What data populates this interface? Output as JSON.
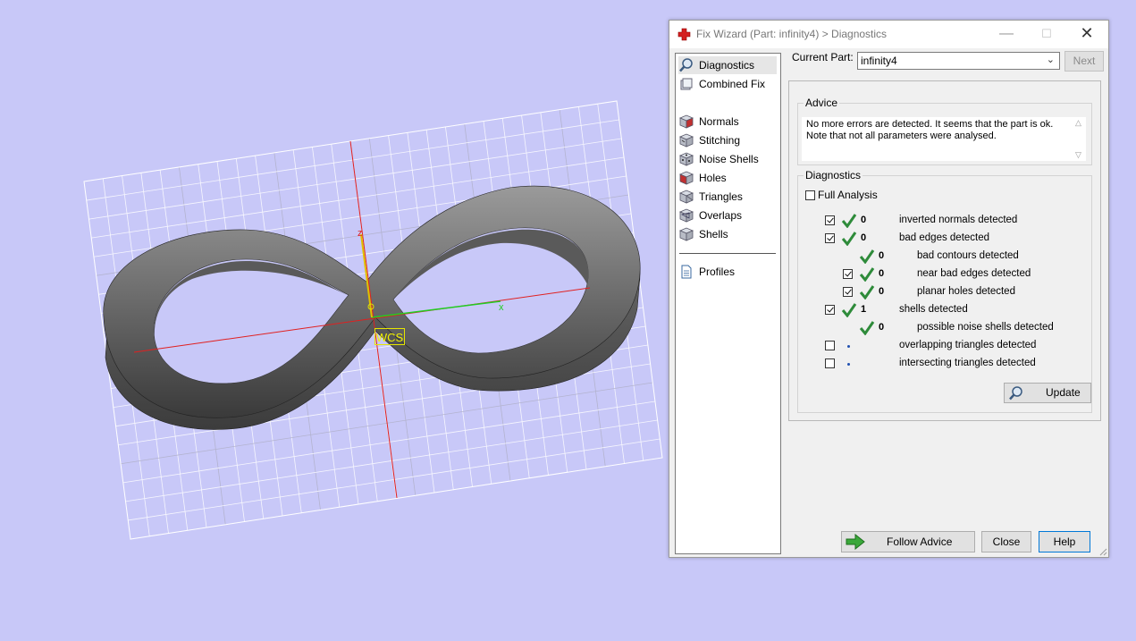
{
  "viewport": {
    "wcs_label": "WCS",
    "axis_x_label": "x",
    "axis_z_label": "z"
  },
  "window": {
    "title": "Fix Wizard (Part: infinity4) > Diagnostics",
    "controls": [
      "minimize",
      "maximize",
      "close"
    ]
  },
  "nav": {
    "items": [
      {
        "label": "Diagnostics",
        "icon": "magnifier-icon",
        "selected": true
      },
      {
        "label": "Combined Fix",
        "icon": "combined-fix-icon"
      },
      {
        "label": "Normals",
        "icon": "normals-cube-icon"
      },
      {
        "label": "Stitching",
        "icon": "stitching-cube-icon"
      },
      {
        "label": "Noise Shells",
        "icon": "noise-shells-icon"
      },
      {
        "label": "Holes",
        "icon": "holes-cube-icon"
      },
      {
        "label": "Triangles",
        "icon": "triangles-cube-icon"
      },
      {
        "label": "Overlaps",
        "icon": "overlaps-cube-icon"
      },
      {
        "label": "Shells",
        "icon": "shells-cube-icon"
      },
      {
        "label": "Profiles",
        "icon": "profiles-document-icon"
      }
    ]
  },
  "current_part": {
    "label": "Current Part:",
    "value": "infinity4",
    "next_label": "Next"
  },
  "advice": {
    "title": "Advice",
    "line1": "No more errors are detected. It seems that the part is ok.",
    "line2": "Note that not all parameters were analysed."
  },
  "diagnostics": {
    "title": "Diagnostics",
    "full_analysis_label": "Full Analysis",
    "full_analysis_checked": false,
    "rows": [
      {
        "checked": true,
        "status": "ok",
        "count": "0",
        "label": "inverted normals detected"
      },
      {
        "checked": true,
        "status": "ok",
        "count": "0",
        "label": "bad edges detected"
      },
      {
        "checked": null,
        "status": "ok",
        "count": "0",
        "label": "bad contours detected"
      },
      {
        "checked": true,
        "status": "ok",
        "count": "0",
        "label": "near bad edges detected"
      },
      {
        "checked": true,
        "status": "ok",
        "count": "0",
        "label": "planar holes detected"
      },
      {
        "checked": true,
        "status": "ok",
        "count": "1",
        "label": "shells detected"
      },
      {
        "checked": null,
        "status": "ok",
        "count": "0",
        "label": "possible noise shells detected"
      },
      {
        "checked": false,
        "status": "not-run",
        "count": "",
        "label": "overlapping triangles detected"
      },
      {
        "checked": false,
        "status": "not-run",
        "count": "",
        "label": "intersecting triangles detected"
      }
    ],
    "update_label": "Update"
  },
  "buttons": {
    "follow_advice": "Follow Advice",
    "close": "Close",
    "help": "Help"
  },
  "colors": {
    "background": "#c8c8f8",
    "check_green": "#2e8b3a",
    "axis_red": "#e02020",
    "axis_green": "#22cc22",
    "wcs_yellow": "#f0f000"
  }
}
